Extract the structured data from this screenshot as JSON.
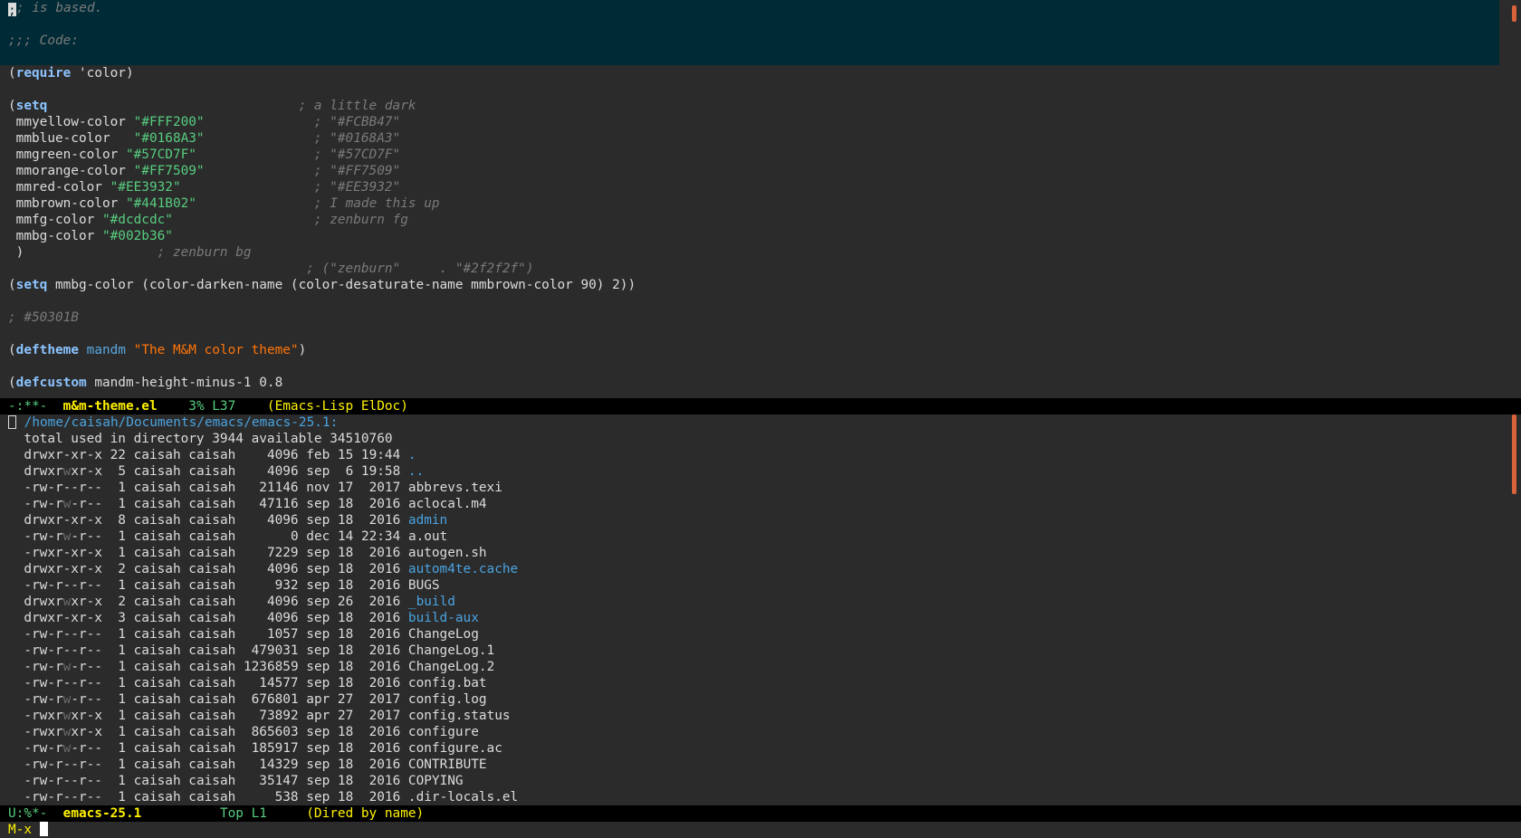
{
  "code_window": {
    "lines": [
      {
        "parts": [
          {
            "t": ";",
            "c": "cursor"
          },
          {
            "t": "; is based.",
            "c": "comment"
          }
        ],
        "hl": true
      },
      {
        "parts": [],
        "hl": true
      },
      {
        "parts": [
          {
            "t": ";;; Code:",
            "c": "comment"
          }
        ],
        "hl": true
      },
      {
        "parts": [],
        "hl": true
      },
      {
        "parts": [
          {
            "t": "(",
            "c": "paren"
          },
          {
            "t": "require",
            "c": "kw"
          },
          {
            "t": " 'color)",
            "c": "plain"
          }
        ]
      },
      {
        "parts": []
      },
      {
        "parts": [
          {
            "t": "(",
            "c": "paren"
          },
          {
            "t": "setq",
            "c": "kw"
          },
          {
            "t": "                                ",
            "c": "plain"
          },
          {
            "t": "; a little dark",
            "c": "comment"
          }
        ]
      },
      {
        "parts": [
          {
            "t": " mmyellow-color ",
            "c": "plain"
          },
          {
            "t": "\"#FFF200\"",
            "c": "str-green"
          },
          {
            "t": "              ",
            "c": "plain"
          },
          {
            "t": "; \"#FCBB47\"",
            "c": "comment"
          }
        ]
      },
      {
        "parts": [
          {
            "t": " mmblue-color   ",
            "c": "plain"
          },
          {
            "t": "\"#0168A3\"",
            "c": "str-green"
          },
          {
            "t": "              ",
            "c": "plain"
          },
          {
            "t": "; \"#0168A3\"",
            "c": "comment"
          }
        ]
      },
      {
        "parts": [
          {
            "t": " mmgreen-color ",
            "c": "plain"
          },
          {
            "t": "\"#57CD7F\"",
            "c": "str-green"
          },
          {
            "t": "               ",
            "c": "plain"
          },
          {
            "t": "; \"#57CD7F\"",
            "c": "comment"
          }
        ]
      },
      {
        "parts": [
          {
            "t": " mmorange-color ",
            "c": "plain"
          },
          {
            "t": "\"#FF7509\"",
            "c": "str-green"
          },
          {
            "t": "              ",
            "c": "plain"
          },
          {
            "t": "; \"#FF7509\"",
            "c": "comment"
          }
        ]
      },
      {
        "parts": [
          {
            "t": " mmred-color ",
            "c": "plain"
          },
          {
            "t": "\"#EE3932\"",
            "c": "str-green"
          },
          {
            "t": "                 ",
            "c": "plain"
          },
          {
            "t": "; \"#EE3932\"",
            "c": "comment"
          }
        ]
      },
      {
        "parts": [
          {
            "t": " mmbrown-color ",
            "c": "plain"
          },
          {
            "t": "\"#441B02\"",
            "c": "str-green"
          },
          {
            "t": "               ",
            "c": "plain"
          },
          {
            "t": "; I made this up",
            "c": "comment"
          }
        ]
      },
      {
        "parts": [
          {
            "t": " mmfg-color ",
            "c": "plain"
          },
          {
            "t": "\"#dcdcdc\"",
            "c": "str-green"
          },
          {
            "t": "                  ",
            "c": "plain"
          },
          {
            "t": "; zenburn fg",
            "c": "comment"
          }
        ]
      },
      {
        "parts": [
          {
            "t": " mmbg-color ",
            "c": "plain"
          },
          {
            "t": "\"#002b36\"",
            "c": "str-green"
          }
        ]
      },
      {
        "parts": [
          {
            "t": " )                 ",
            "c": "plain"
          },
          {
            "t": "; zenburn bg",
            "c": "comment"
          }
        ]
      },
      {
        "parts": [
          {
            "t": "                                      ",
            "c": "plain"
          },
          {
            "t": "; (\"zenburn\"     . \"#2f2f2f\")",
            "c": "comment"
          }
        ]
      },
      {
        "parts": [
          {
            "t": "(",
            "c": "paren"
          },
          {
            "t": "setq",
            "c": "kw"
          },
          {
            "t": " mmbg-color (color-darken-name (color-desaturate-name mmbrown-color 90) 2))",
            "c": "plain"
          }
        ]
      },
      {
        "parts": []
      },
      {
        "parts": [
          {
            "t": "; #50301B",
            "c": "comment"
          }
        ]
      },
      {
        "parts": []
      },
      {
        "parts": [
          {
            "t": "(",
            "c": "paren"
          },
          {
            "t": "deftheme",
            "c": "kw"
          },
          {
            "t": " ",
            "c": "plain"
          },
          {
            "t": "mandm",
            "c": "fn-name"
          },
          {
            "t": " ",
            "c": "plain"
          },
          {
            "t": "\"The M&M color theme\"",
            "c": "str-orange"
          },
          {
            "t": ")",
            "c": "plain"
          }
        ]
      },
      {
        "parts": []
      },
      {
        "parts": [
          {
            "t": "(",
            "c": "paren"
          },
          {
            "t": "defcustom",
            "c": "kw"
          },
          {
            "t": " mandm-height-minus-1 0.8",
            "c": "plain"
          }
        ]
      }
    ]
  },
  "code_modeline": {
    "state": "-:**-",
    "buffer": "m&m-theme.el",
    "position": "3% L37",
    "modes": "(Emacs-Lisp ElDoc)"
  },
  "dired": {
    "header": "/home/caisah/Documents/emacs/emacs-25.1:",
    "total": "total used in directory 3944 available 34510760",
    "entries": [
      {
        "perm": "drwxr-xr-x",
        "links": "22",
        "owner": "caisah",
        "group": "caisah",
        "size": "4096",
        "date": "feb 15 19:44",
        "name": ".",
        "dir": true
      },
      {
        "perm": "drwxrwxr-x",
        "links": " 5",
        "owner": "caisah",
        "group": "caisah",
        "size": "4096",
        "date": "sep  6 19:58",
        "name": "..",
        "dir": true
      },
      {
        "perm": "-rw-r--r--",
        "links": " 1",
        "owner": "caisah",
        "group": "caisah",
        "size": "21146",
        "date": "nov 17  2017",
        "name": "abbrevs.texi",
        "dir": false
      },
      {
        "perm": "-rw-rw-r--",
        "links": " 1",
        "owner": "caisah",
        "group": "caisah",
        "size": "47116",
        "date": "sep 18  2016",
        "name": "aclocal.m4",
        "dir": false
      },
      {
        "perm": "drwxr-xr-x",
        "links": " 8",
        "owner": "caisah",
        "group": "caisah",
        "size": "4096",
        "date": "sep 18  2016",
        "name": "admin",
        "dir": true
      },
      {
        "perm": "-rw-rw-r--",
        "links": " 1",
        "owner": "caisah",
        "group": "caisah",
        "size": "0",
        "date": "dec 14 22:34",
        "name": "a.out",
        "dir": false
      },
      {
        "perm": "-rwxr-xr-x",
        "links": " 1",
        "owner": "caisah",
        "group": "caisah",
        "size": "7229",
        "date": "sep 18  2016",
        "name": "autogen.sh",
        "dir": false
      },
      {
        "perm": "drwxr-xr-x",
        "links": " 2",
        "owner": "caisah",
        "group": "caisah",
        "size": "4096",
        "date": "sep 18  2016",
        "name": "autom4te.cache",
        "dir": true
      },
      {
        "perm": "-rw-r--r--",
        "links": " 1",
        "owner": "caisah",
        "group": "caisah",
        "size": "932",
        "date": "sep 18  2016",
        "name": "BUGS",
        "dir": false
      },
      {
        "perm": "drwxrwxr-x",
        "links": " 2",
        "owner": "caisah",
        "group": "caisah",
        "size": "4096",
        "date": "sep 26  2016",
        "name": "_build",
        "dir": true
      },
      {
        "perm": "drwxr-xr-x",
        "links": " 3",
        "owner": "caisah",
        "group": "caisah",
        "size": "4096",
        "date": "sep 18  2016",
        "name": "build-aux",
        "dir": true
      },
      {
        "perm": "-rw-r--r--",
        "links": " 1",
        "owner": "caisah",
        "group": "caisah",
        "size": "1057",
        "date": "sep 18  2016",
        "name": "ChangeLog",
        "dir": false
      },
      {
        "perm": "-rw-r--r--",
        "links": " 1",
        "owner": "caisah",
        "group": "caisah",
        "size": "479031",
        "date": "sep 18  2016",
        "name": "ChangeLog.1",
        "dir": false
      },
      {
        "perm": "-rw-rw-r--",
        "links": " 1",
        "owner": "caisah",
        "group": "caisah",
        "size": "1236859",
        "date": "sep 18  2016",
        "name": "ChangeLog.2",
        "dir": false
      },
      {
        "perm": "-rw-r--r--",
        "links": " 1",
        "owner": "caisah",
        "group": "caisah",
        "size": "14577",
        "date": "sep 18  2016",
        "name": "config.bat",
        "dir": false
      },
      {
        "perm": "-rw-rw-r--",
        "links": " 1",
        "owner": "caisah",
        "group": "caisah",
        "size": "676801",
        "date": "apr 27  2017",
        "name": "config.log",
        "dir": false
      },
      {
        "perm": "-rwxrwxr-x",
        "links": " 1",
        "owner": "caisah",
        "group": "caisah",
        "size": "73892",
        "date": "apr 27  2017",
        "name": "config.status",
        "dir": false
      },
      {
        "perm": "-rwxrwxr-x",
        "links": " 1",
        "owner": "caisah",
        "group": "caisah",
        "size": "865603",
        "date": "sep 18  2016",
        "name": "configure",
        "dir": false
      },
      {
        "perm": "-rw-rw-r--",
        "links": " 1",
        "owner": "caisah",
        "group": "caisah",
        "size": "185917",
        "date": "sep 18  2016",
        "name": "configure.ac",
        "dir": false
      },
      {
        "perm": "-rw-r--r--",
        "links": " 1",
        "owner": "caisah",
        "group": "caisah",
        "size": "14329",
        "date": "sep 18  2016",
        "name": "CONTRIBUTE",
        "dir": false
      },
      {
        "perm": "-rw-r--r--",
        "links": " 1",
        "owner": "caisah",
        "group": "caisah",
        "size": "35147",
        "date": "sep 18  2016",
        "name": "COPYING",
        "dir": false
      },
      {
        "perm": "-rw-r--r--",
        "links": " 1",
        "owner": "caisah",
        "group": "caisah",
        "size": "538",
        "date": "sep 18  2016",
        "name": ".dir-locals.el",
        "dir": false
      }
    ]
  },
  "dired_modeline": {
    "state": "U:%*-",
    "buffer": "emacs-25.1",
    "position": "Top L1",
    "modes": "(Dired by name)"
  },
  "minibuffer": {
    "prompt": "M-x"
  },
  "colors": {
    "hl_line": "#002b36",
    "background": "#2b2b2b",
    "accent_yellow": "#FFF200",
    "accent_green": "#57CD7F",
    "scroll_thumb": "#d8623a"
  },
  "icons": {
    "scrollbar_thumb": "scroll-thumb-icon",
    "cursor": "cursor-icon"
  }
}
